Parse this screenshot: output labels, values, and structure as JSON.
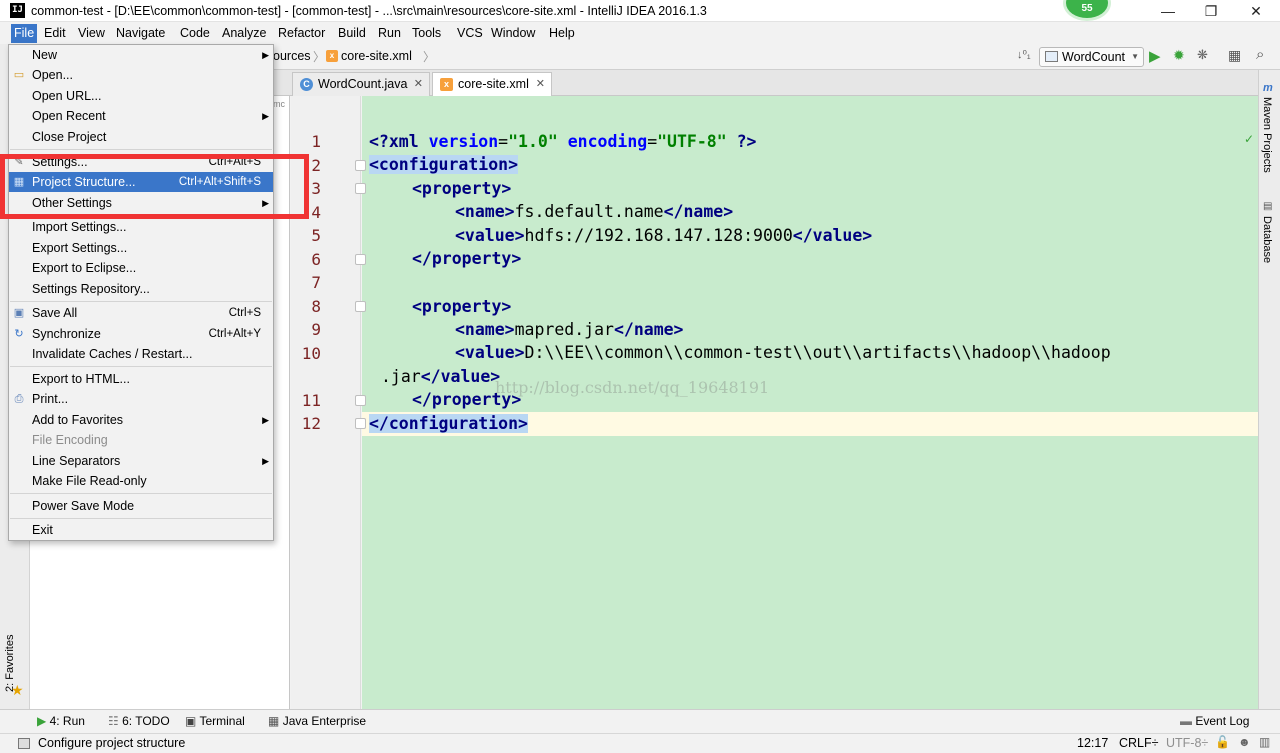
{
  "window": {
    "title": "common-test - [D:\\EE\\common\\common-test] - [common-test] - ...\\src\\main\\resources\\core-site.xml - IntelliJ IDEA 2016.1.3",
    "badge": "55",
    "minimize_glyph": "—",
    "restore_glyph": "❐",
    "close_glyph": "✕"
  },
  "menubar": {
    "items": [
      "File",
      "Edit",
      "View",
      "Navigate",
      "Code",
      "Analyze",
      "Refactor",
      "Build",
      "Run",
      "Tools",
      "VCS",
      "Window",
      "Help"
    ]
  },
  "navbar": {
    "breadcrumb_partial": "ources",
    "breadcrumb_file": "core-site.xml",
    "run_config": "WordCount"
  },
  "tabs": [
    {
      "label": "WordCount.java",
      "icon": "class-icon"
    },
    {
      "label": "core-site.xml",
      "icon": "xml-file-icon"
    }
  ],
  "file_menu": {
    "items": [
      {
        "label": "New",
        "submenu": true
      },
      {
        "label": "Open...",
        "icon": "folder-icon"
      },
      {
        "label": "Open URL..."
      },
      {
        "label": "Open Recent",
        "submenu": true
      },
      {
        "label": "Close Project"
      },
      {
        "label": "Settings...",
        "shortcut": "Ctrl+Alt+S",
        "icon": "wrench-icon"
      },
      {
        "label": "Project Structure...",
        "shortcut": "Ctrl+Alt+Shift+S",
        "selected": true,
        "icon": "project-structure-icon"
      },
      {
        "label": "Other Settings",
        "submenu": true
      },
      {
        "label": "Import Settings..."
      },
      {
        "label": "Export Settings..."
      },
      {
        "label": "Export to Eclipse..."
      },
      {
        "label": "Settings Repository..."
      },
      {
        "label": "Save All",
        "shortcut": "Ctrl+S",
        "icon": "save-icon"
      },
      {
        "label": "Synchronize",
        "shortcut": "Ctrl+Alt+Y",
        "icon": "sync-icon"
      },
      {
        "label": "Invalidate Caches / Restart..."
      },
      {
        "label": "Export to HTML..."
      },
      {
        "label": "Print...",
        "icon": "print-icon"
      },
      {
        "label": "Add to Favorites",
        "submenu": true
      },
      {
        "label": "File Encoding",
        "disabled": true
      },
      {
        "label": "Line Separators",
        "submenu": true
      },
      {
        "label": "Make File Read-only"
      },
      {
        "label": "Power Save Mode"
      },
      {
        "label": "Exit"
      }
    ]
  },
  "editor": {
    "line_numbers": [
      "1",
      "2",
      "3",
      "4",
      "5",
      "6",
      "7",
      "8",
      "9",
      "10",
      "11",
      "12"
    ],
    "code": {
      "l1_open": "<?",
      "l1_xml": "xml ",
      "l1_attr1": "version",
      "l1_eq1": "=",
      "l1_val1": "\"1.0\"",
      "l1_attr2": " encoding",
      "l1_eq2": "=",
      "l1_val2": "\"UTF-8\"",
      "l1_close": " ?>",
      "l2": "<configuration>",
      "l3": "<property>",
      "l4_open": "<name>",
      "l4_text": "fs.default.name",
      "l4_close": "</name>",
      "l5_open": "<value>",
      "l5_text": "hdfs://192.168.147.128:9000",
      "l5_close": "</value>",
      "l6": "</property>",
      "l8": "<property>",
      "l9_open": "<name>",
      "l9_text": "mapred.jar",
      "l9_close": "</name>",
      "l10_open": "<value>",
      "l10_text": "D:\\\\EE\\\\common\\\\common-test\\\\out\\\\artifacts\\\\hadoop\\\\hadoop",
      "l10b_text": ".jar",
      "l10b_close": "</value>",
      "l11": "</property>",
      "l12": "</configuration>"
    },
    "watermark": "http://blog.csdn.net/qq_19648191"
  },
  "left_strip": {
    "favorites": "2: Favorites"
  },
  "right_strip": {
    "maven": "Maven Projects",
    "database": "Database"
  },
  "bottom_tools": [
    {
      "label": "4: Run",
      "icon": "run-icon"
    },
    {
      "label": "6: TODO",
      "icon": "todo-icon"
    },
    {
      "label": "Terminal",
      "icon": "terminal-icon"
    },
    {
      "label": "Java Enterprise",
      "icon": "java-enterprise-icon"
    }
  ],
  "event_log": "Event Log",
  "status": {
    "message": "Configure project structure",
    "position": "12:17",
    "line_sep": "CRLF÷",
    "encoding": "UTF-8÷"
  },
  "colors": {
    "editor_bg": "#c8ebcd",
    "selection": "#3a76c9",
    "highlight_box": "#f03333"
  }
}
